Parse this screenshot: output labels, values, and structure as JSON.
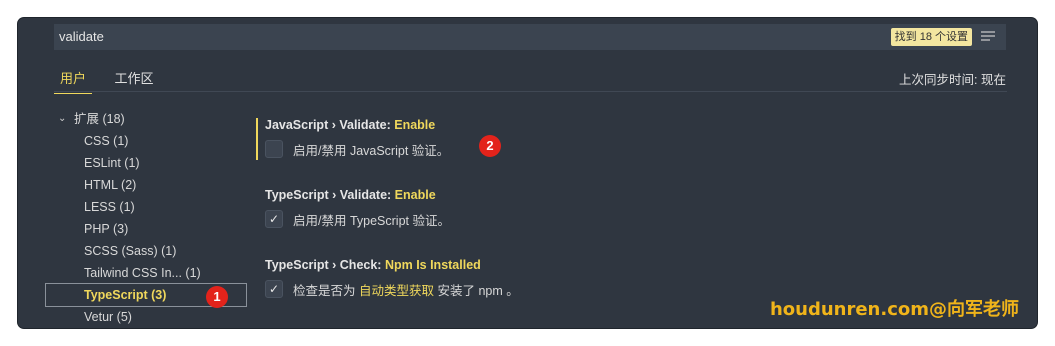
{
  "search": {
    "value": "validate",
    "result_count": "找到 18 个设置"
  },
  "tabs": [
    {
      "label": "用户",
      "active": true
    },
    {
      "label": "工作区",
      "active": false
    }
  ],
  "sync_status": "上次同步时间: 现在",
  "toc": {
    "group": {
      "label": "扩展 (18)"
    },
    "items": [
      {
        "label": "CSS (1)"
      },
      {
        "label": "ESLint (1)"
      },
      {
        "label": "HTML (2)"
      },
      {
        "label": "LESS (1)"
      },
      {
        "label": "PHP (3)"
      },
      {
        "label": "SCSS (Sass) (1)"
      },
      {
        "label": "Tailwind CSS In... (1)"
      },
      {
        "label": "TypeScript (3)"
      },
      {
        "label": "Vetur (5)"
      }
    ]
  },
  "settings": [
    {
      "prefix": "JavaScript › Validate: ",
      "key": "Enable",
      "desc": "启用/禁用 JavaScript 验证。",
      "checked": false
    },
    {
      "prefix": "TypeScript › Validate: ",
      "key": "Enable",
      "desc": "启用/禁用 TypeScript 验证。",
      "checked": true
    },
    {
      "prefix": "TypeScript › Check: ",
      "key": "Npm Is Installed",
      "desc_before": "检查是否为 ",
      "desc_link": "自动类型获取",
      "desc_after": " 安装了 npm 。",
      "checked": true
    }
  ],
  "markers": [
    "1",
    "2"
  ],
  "watermark": "houdunren.com@向军老师",
  "colors": {
    "accent": "#f0d85c",
    "background": "#2f3640",
    "marker": "#e3231b",
    "watermark": "#f0b41a"
  }
}
